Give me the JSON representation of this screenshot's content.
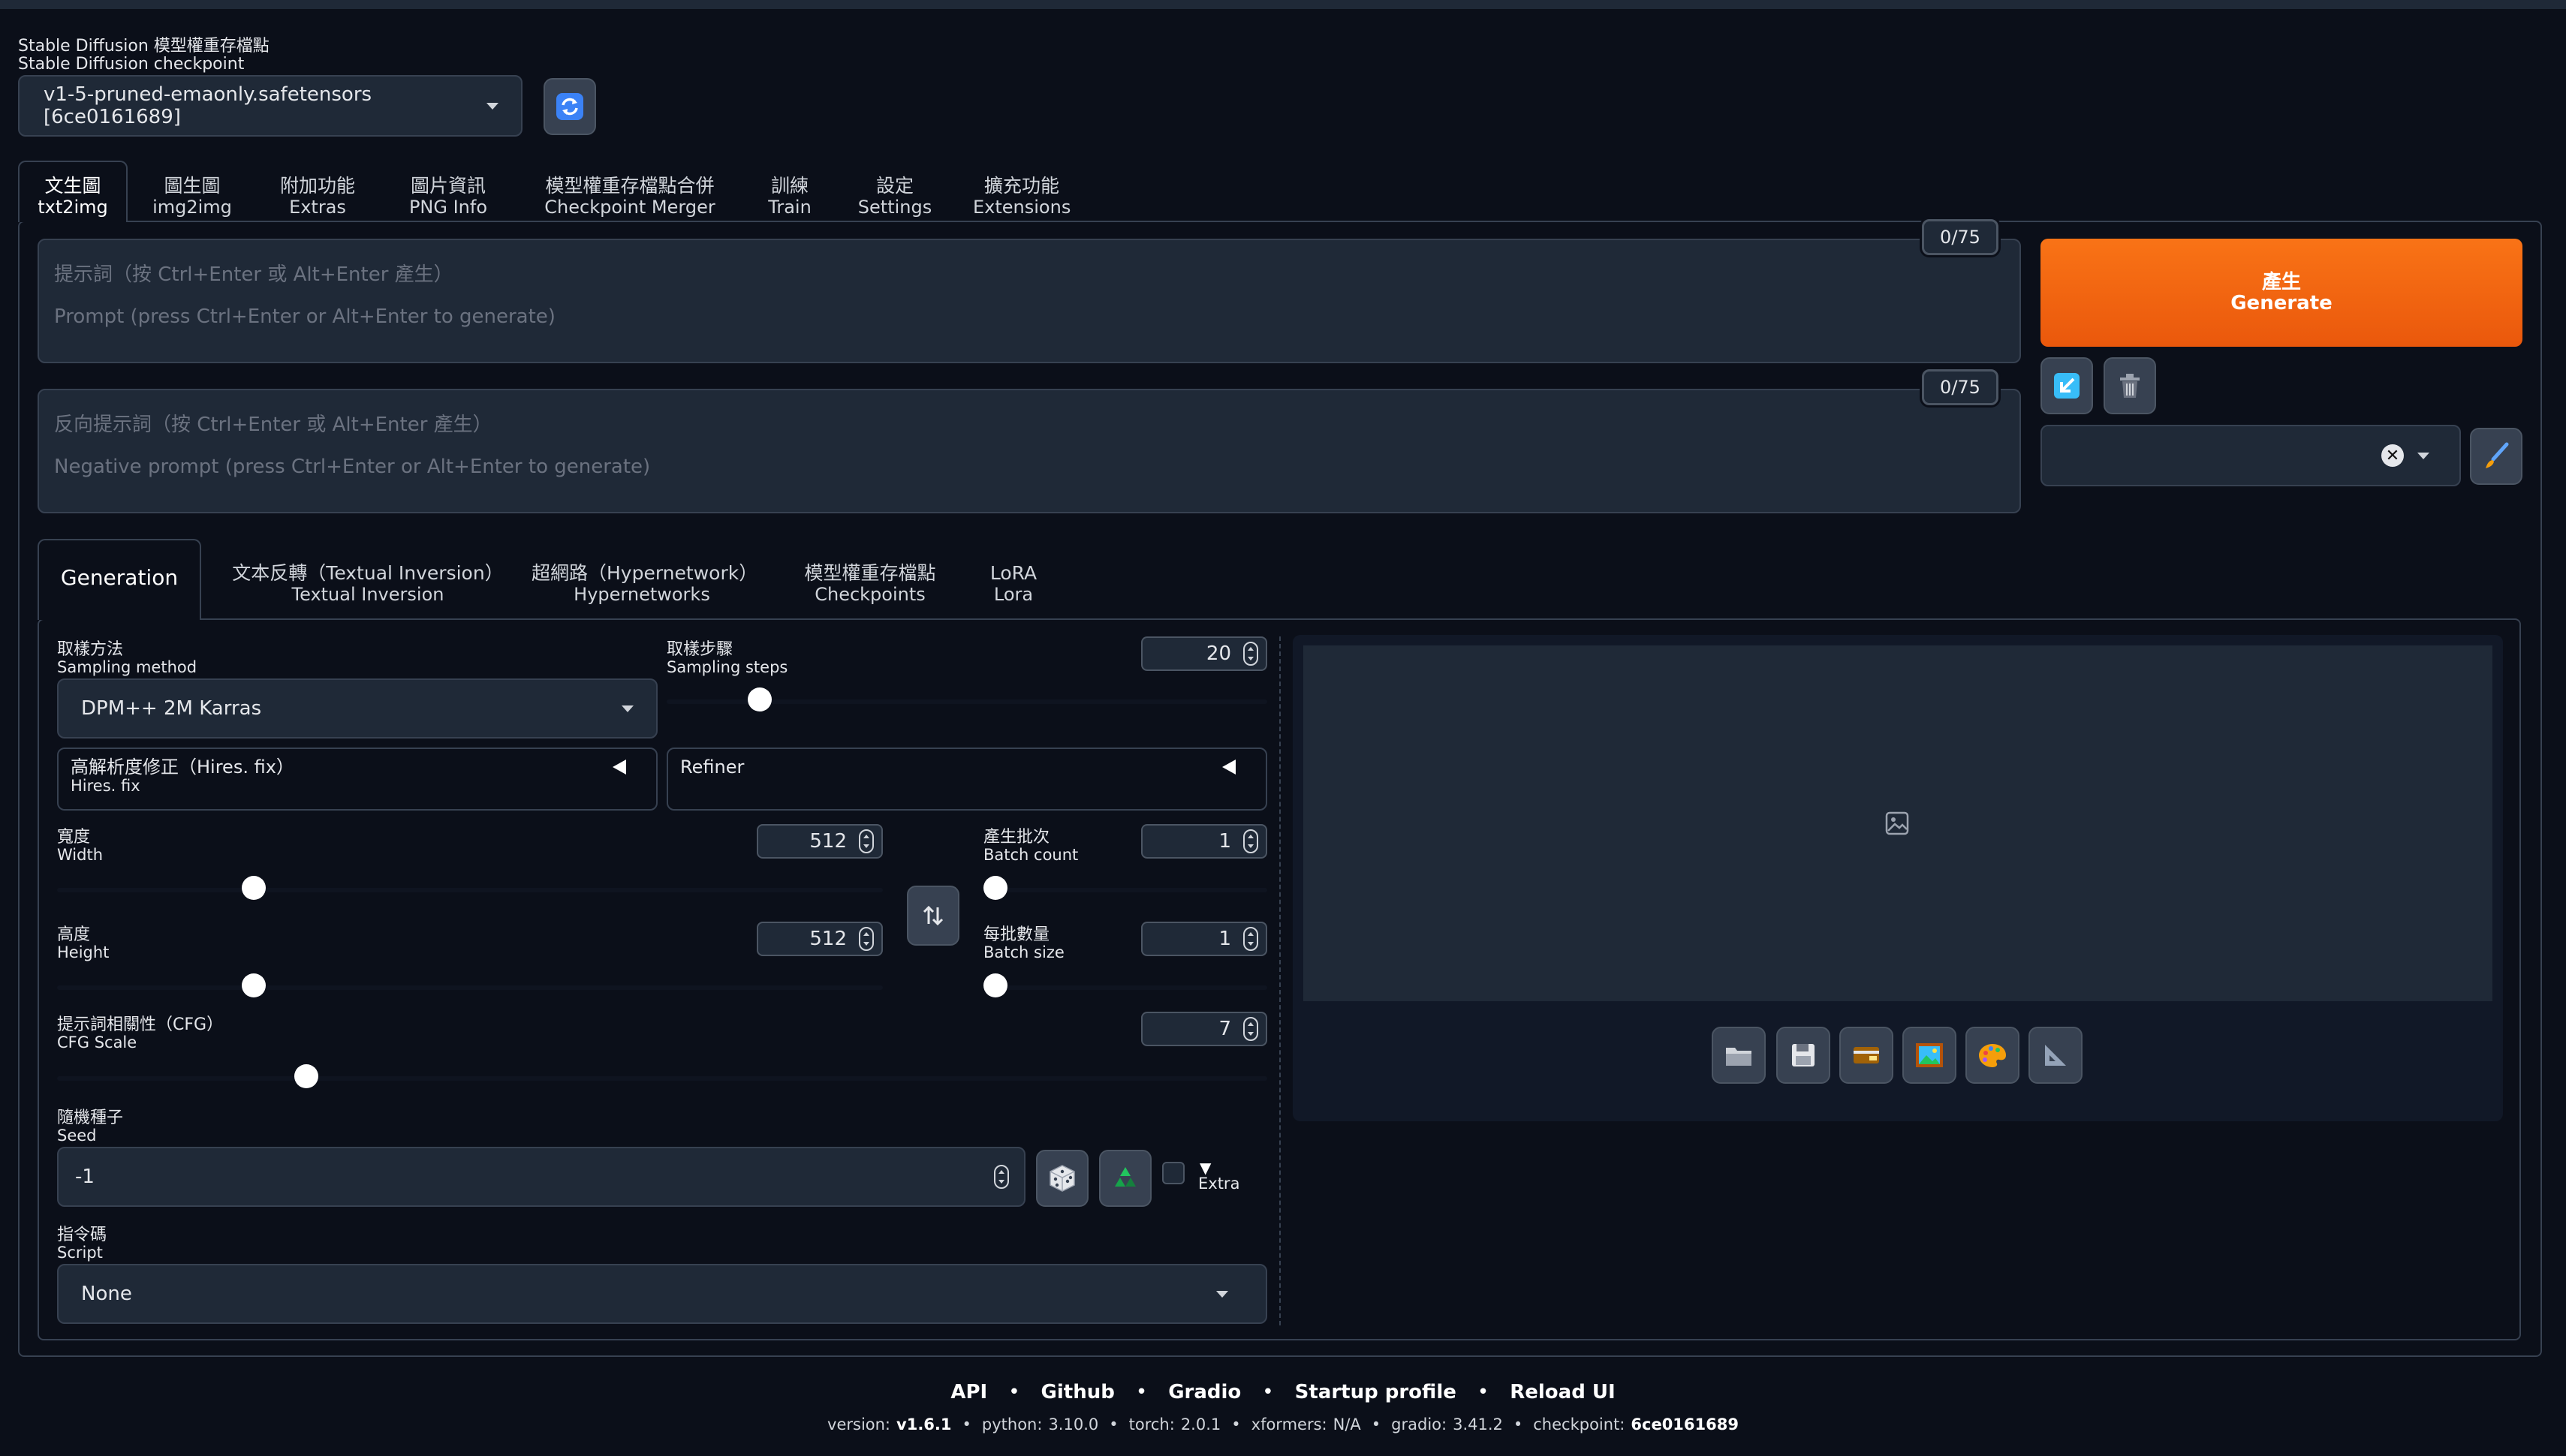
{
  "checkpoint": {
    "label_zh": "Stable Diffusion 模型權重存檔點",
    "label_en": "Stable Diffusion checkpoint",
    "value": "v1-5-pruned-emaonly.safetensors [6ce0161689]"
  },
  "main_tabs": [
    {
      "zh": "文生圖",
      "en": "txt2img"
    },
    {
      "zh": "圖生圖",
      "en": "img2img"
    },
    {
      "zh": "附加功能",
      "en": "Extras"
    },
    {
      "zh": "圖片資訊",
      "en": "PNG Info"
    },
    {
      "zh": "模型權重存檔點合併",
      "en": "Checkpoint Merger"
    },
    {
      "zh": "訓練",
      "en": "Train"
    },
    {
      "zh": "設定",
      "en": "Settings"
    },
    {
      "zh": "擴充功能",
      "en": "Extensions"
    }
  ],
  "prompt": {
    "placeholder_zh": "提示詞（按 Ctrl+Enter 或 Alt+Enter 產生）",
    "placeholder_en": "Prompt (press Ctrl+Enter or Alt+Enter to generate)",
    "counter": "0/75"
  },
  "negative_prompt": {
    "placeholder_zh": "反向提示詞（按 Ctrl+Enter 或 Alt+Enter 產生）",
    "placeholder_en": "Negative prompt (press Ctrl+Enter or Alt+Enter to generate)",
    "counter": "0/75"
  },
  "generate": {
    "zh": "產生",
    "en": "Generate"
  },
  "sub_tabs": [
    {
      "zh": "Generation",
      "en": ""
    },
    {
      "zh": "文本反轉（Textual Inversion）",
      "en": "Textual Inversion"
    },
    {
      "zh": "超網路（Hypernetwork）",
      "en": "Hypernetworks"
    },
    {
      "zh": "模型權重存檔點",
      "en": "Checkpoints"
    },
    {
      "zh": "LoRA",
      "en": "Lora"
    }
  ],
  "sampling_method": {
    "zh": "取樣方法",
    "en": "Sampling method",
    "value": "DPM++ 2M Karras"
  },
  "sampling_steps": {
    "zh": "取樣步驟",
    "en": "Sampling steps",
    "value": "20",
    "fraction": 0.14
  },
  "hires_fix": {
    "zh": "高解析度修正（Hires. fix）",
    "en": "Hires. fix"
  },
  "refiner": {
    "label": "Refiner"
  },
  "width": {
    "zh": "寬度",
    "en": "Width",
    "value": "512",
    "fraction": 0.23
  },
  "height": {
    "zh": "高度",
    "en": "Height",
    "value": "512",
    "fraction": 0.23
  },
  "batch_count": {
    "zh": "產生批次",
    "en": "Batch count",
    "value": "1",
    "fraction": 0.0
  },
  "batch_size": {
    "zh": "每批數量",
    "en": "Batch size",
    "value": "1",
    "fraction": 0.0
  },
  "cfg_scale": {
    "zh": "提示詞相關性（CFG）",
    "en": "CFG Scale",
    "value": "7",
    "fraction": 0.2
  },
  "seed": {
    "zh": "隨機種子",
    "en": "Seed",
    "value": "-1",
    "extra_label": "Extra"
  },
  "script": {
    "zh": "指令碼",
    "en": "Script",
    "value": "None"
  },
  "footer": {
    "links": [
      "API",
      "Github",
      "Gradio",
      "Startup profile",
      "Reload UI"
    ],
    "separator": "•",
    "version_label": "version:",
    "version": "v1.6.1",
    "python_label": "python:",
    "python": "3.10.0",
    "torch_label": "torch:",
    "torch": "2.0.1",
    "xformers_label": "xformers:",
    "xformers": "N/A",
    "gradio_label": "gradio:",
    "gradio": "3.41.2",
    "checkpoint_label": "checkpoint:",
    "checkpoint": "6ce0161689"
  },
  "colors": {
    "accent": "#ea580c",
    "background": "#0b0f19",
    "panel": "#1f2937",
    "border": "#374151"
  }
}
